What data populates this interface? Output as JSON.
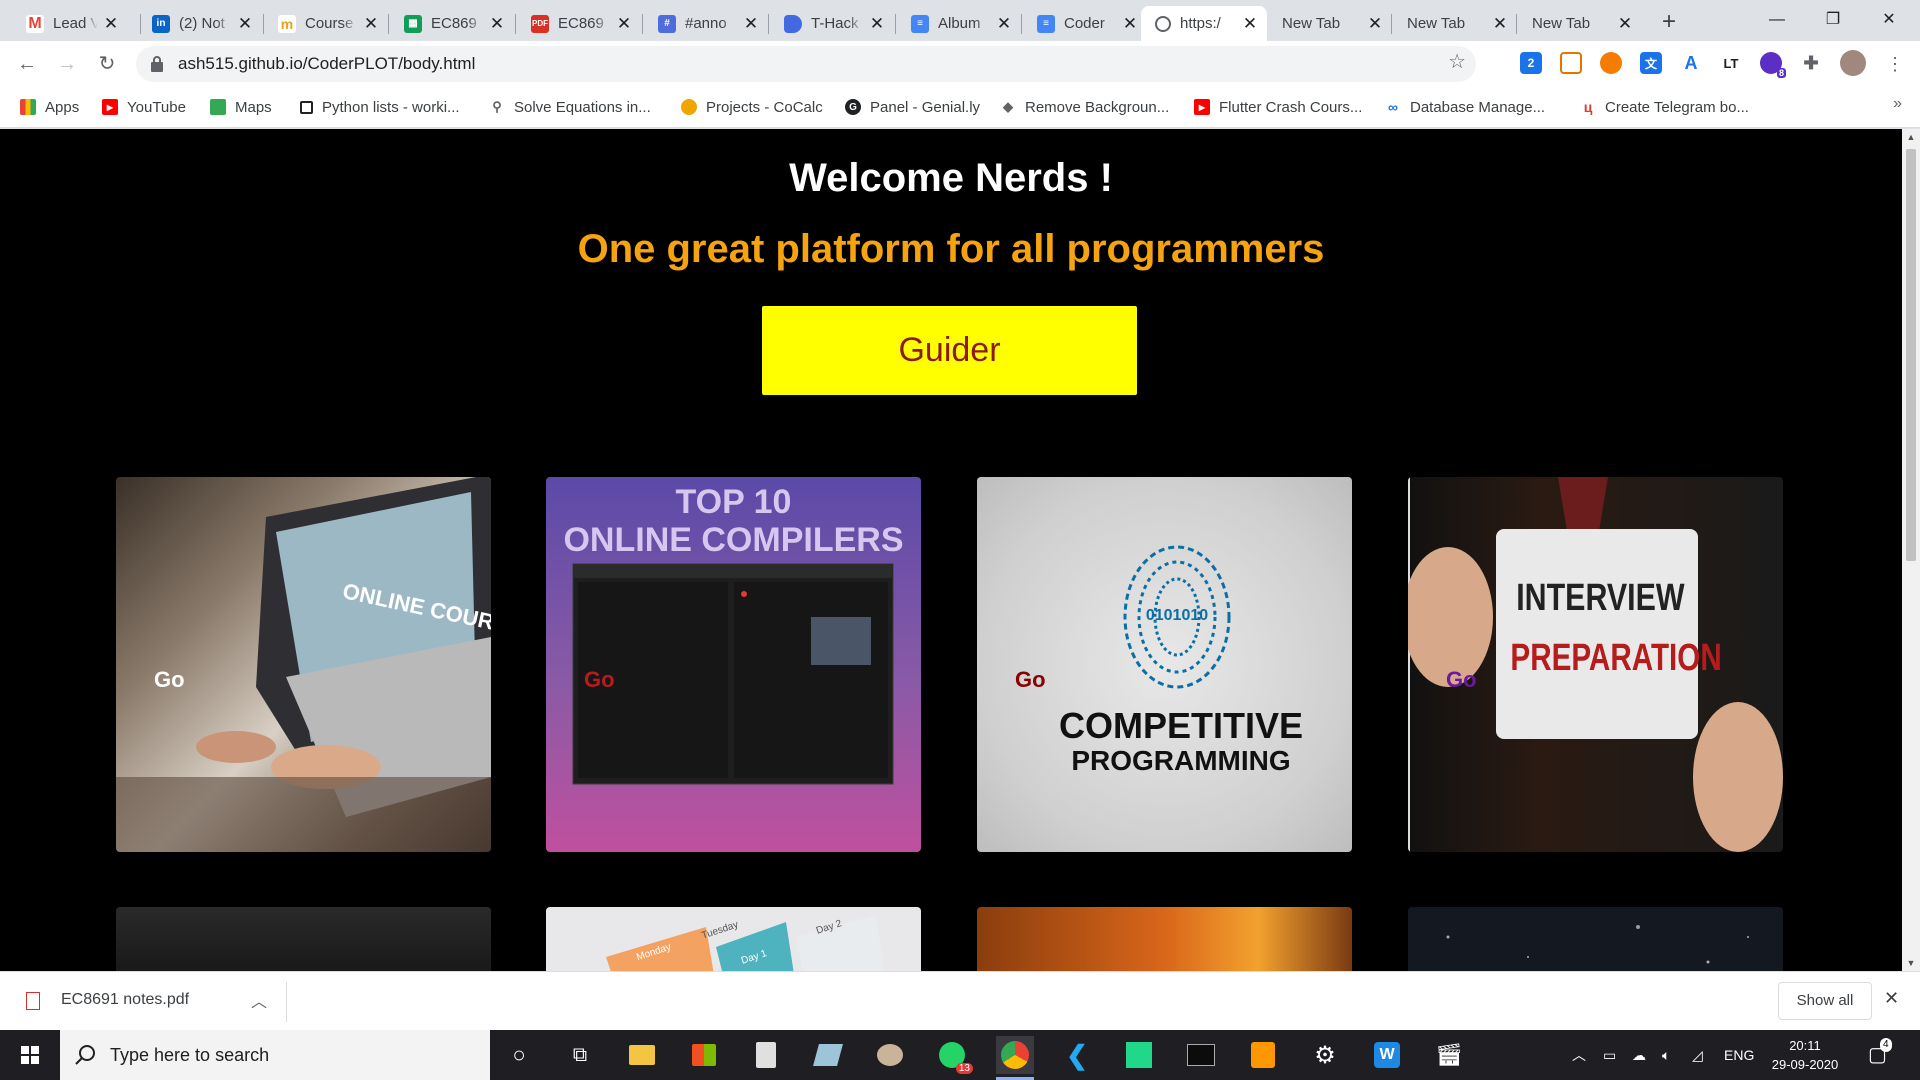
{
  "tabs": [
    {
      "title": "Lead V",
      "icon": "gmail-icon",
      "color": "#ea4335"
    },
    {
      "title": "(2) Not",
      "icon": "linkedin-icon",
      "color": "#0a66c2"
    },
    {
      "title": "Course",
      "icon": "coursera-icon",
      "color": "#e8a317"
    },
    {
      "title": "EC869",
      "icon": "sheets-icon",
      "color": "#0f9d58"
    },
    {
      "title": "EC869",
      "icon": "pdf-icon",
      "color": "#d93025"
    },
    {
      "title": "#anno",
      "icon": "annotation-icon",
      "color": "#4e6cdb"
    },
    {
      "title": "T-Hack",
      "icon": "doc-blue-icon",
      "color": "#4169e1"
    },
    {
      "title": "Album",
      "icon": "docs-icon",
      "color": "#4285f4"
    },
    {
      "title": "Coder",
      "icon": "docs-icon",
      "color": "#4285f4"
    },
    {
      "title": "https:/",
      "icon": "globe-icon",
      "color": "#5f6368"
    },
    {
      "title": "New Tab",
      "icon": "",
      "color": ""
    },
    {
      "title": "New Tab",
      "icon": "",
      "color": ""
    },
    {
      "title": "New Tab",
      "icon": "",
      "color": ""
    }
  ],
  "address_bar": {
    "url": "ash515.github.io/CoderPLOT/body.html"
  },
  "extensions": [
    {
      "icon": "extension-2-icon",
      "label": "2",
      "color": "#1a73e8"
    },
    {
      "icon": "extension-screen-icon",
      "label": "",
      "color": "#e37400"
    },
    {
      "icon": "extension-orange-icon",
      "label": "",
      "color": "#f57c00"
    },
    {
      "icon": "translate-icon",
      "label": "",
      "color": "#1a73e8"
    },
    {
      "icon": "font-icon",
      "label": "A",
      "color": "#ffffff"
    },
    {
      "icon": "lt-icon",
      "label": "LT",
      "color": "#ffffff"
    },
    {
      "icon": "extension-badge-icon",
      "label": "8",
      "color": "#5b2fc5"
    },
    {
      "icon": "puzzle-icon",
      "label": "",
      "color": "#5f6368"
    }
  ],
  "bookmarks": [
    {
      "label": "Apps",
      "icon": "apps-grid-icon",
      "color": "#ea4335"
    },
    {
      "label": "YouTube",
      "icon": "youtube-icon",
      "color": "#ff0000"
    },
    {
      "label": "Maps",
      "icon": "maps-icon",
      "color": "#34a853"
    },
    {
      "label": "Python lists - worki...",
      "icon": "square-icon",
      "color": "#202124"
    },
    {
      "label": "Solve Equations in...",
      "icon": "search-magnifier-icon",
      "color": "#5f6368"
    },
    {
      "label": "Projects - CoCalc",
      "icon": "cocalc-icon",
      "color": "#f0a500"
    },
    {
      "label": "Panel - Genial.ly",
      "icon": "genially-icon",
      "color": "#202124"
    },
    {
      "label": "Remove Backgroun...",
      "icon": "layers-icon",
      "color": "#5f6368"
    },
    {
      "label": "Flutter Crash Cours...",
      "icon": "youtube-icon",
      "color": "#ff0000"
    },
    {
      "label": "Database Manage...",
      "icon": "infinity-icon",
      "color": "#1a73e8"
    },
    {
      "label": "Create Telegram bo...",
      "icon": "telegram-u-icon",
      "color": "#e53935"
    }
  ],
  "page": {
    "welcome": "Welcome Nerds !",
    "tagline": "One great platform for all programmers",
    "guider_button": "Guider",
    "cards": [
      {
        "caption": "ONLINE COURSE",
        "go": "Go",
        "go_color": "#ffffff"
      },
      {
        "caption_line1": "TOP 10",
        "caption_line2": "ONLINE COMPILERS",
        "go": "Go",
        "go_color": "#b71c1c"
      },
      {
        "binary": "0101010",
        "caption_line1": "COMPETITIVE",
        "caption_line2": "PROGRAMMING",
        "go": "Go",
        "go_color": "#8b0000"
      },
      {
        "caption_line1": "INTERVIEW",
        "caption_line2": "PREPARATION",
        "go": "Go",
        "go_color": "#6a1b9a"
      }
    ],
    "row2_cards": [
      {
        "label_a": "Monday",
        "label_b": "Tuesday",
        "label_c": "Day 1",
        "label_d": "Day 2"
      }
    ]
  },
  "download_bar": {
    "file": "EC8691 notes.pdf",
    "show_all": "Show all"
  },
  "taskbar": {
    "search_placeholder": "Type here to search",
    "whatsapp_badge": "13",
    "language": "ENG",
    "time": "20:11",
    "date": "29-09-2020",
    "notification_count": "4"
  }
}
